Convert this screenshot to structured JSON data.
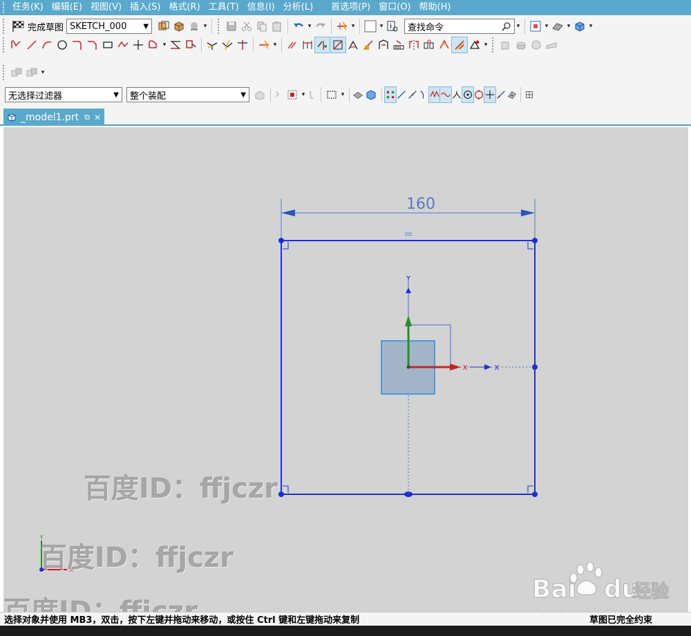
{
  "menubar": {
    "items": [
      "任务(K)",
      "编辑(E)",
      "视图(V)",
      "插入(S)",
      "格式(R)",
      "工具(T)",
      "信息(I)",
      "分析(L)",
      "首选项(P)",
      "窗口(O)",
      "帮助(H)"
    ]
  },
  "toolbar": {
    "finish_sketch_label": "完成草图",
    "sketch_name": "SKETCH_000",
    "search_placeholder": "查找命令",
    "selection_filter": "无选择过滤器",
    "assembly_scope": "整个装配"
  },
  "tab": {
    "title": "_model1.prt"
  },
  "sketch": {
    "dimension_value": "160",
    "equal_constraint": "=",
    "axis_x": "X",
    "axis_y": "Y"
  },
  "watermarks": [
    "百度ID：ffjczr",
    "百度ID：ffjczr",
    "百度ID：ffjczr"
  ],
  "status": {
    "prompt": "选择对象并使用 MB3，双击，按下左键并拖动来移动，或按住 Ctrl 键和左键拖动来复制",
    "state": "草图已完全约束"
  },
  "brand": {
    "logo_text": "Bai",
    "logo_text2": "du",
    "logo_suffix": "经验",
    "logo_url": "jingyan.baidu.com"
  },
  "colors": {
    "menubar_bg": "#5aa9cc",
    "sketch_blue": "#1a2fd6",
    "viewport_bg": "#d3d3d3"
  }
}
